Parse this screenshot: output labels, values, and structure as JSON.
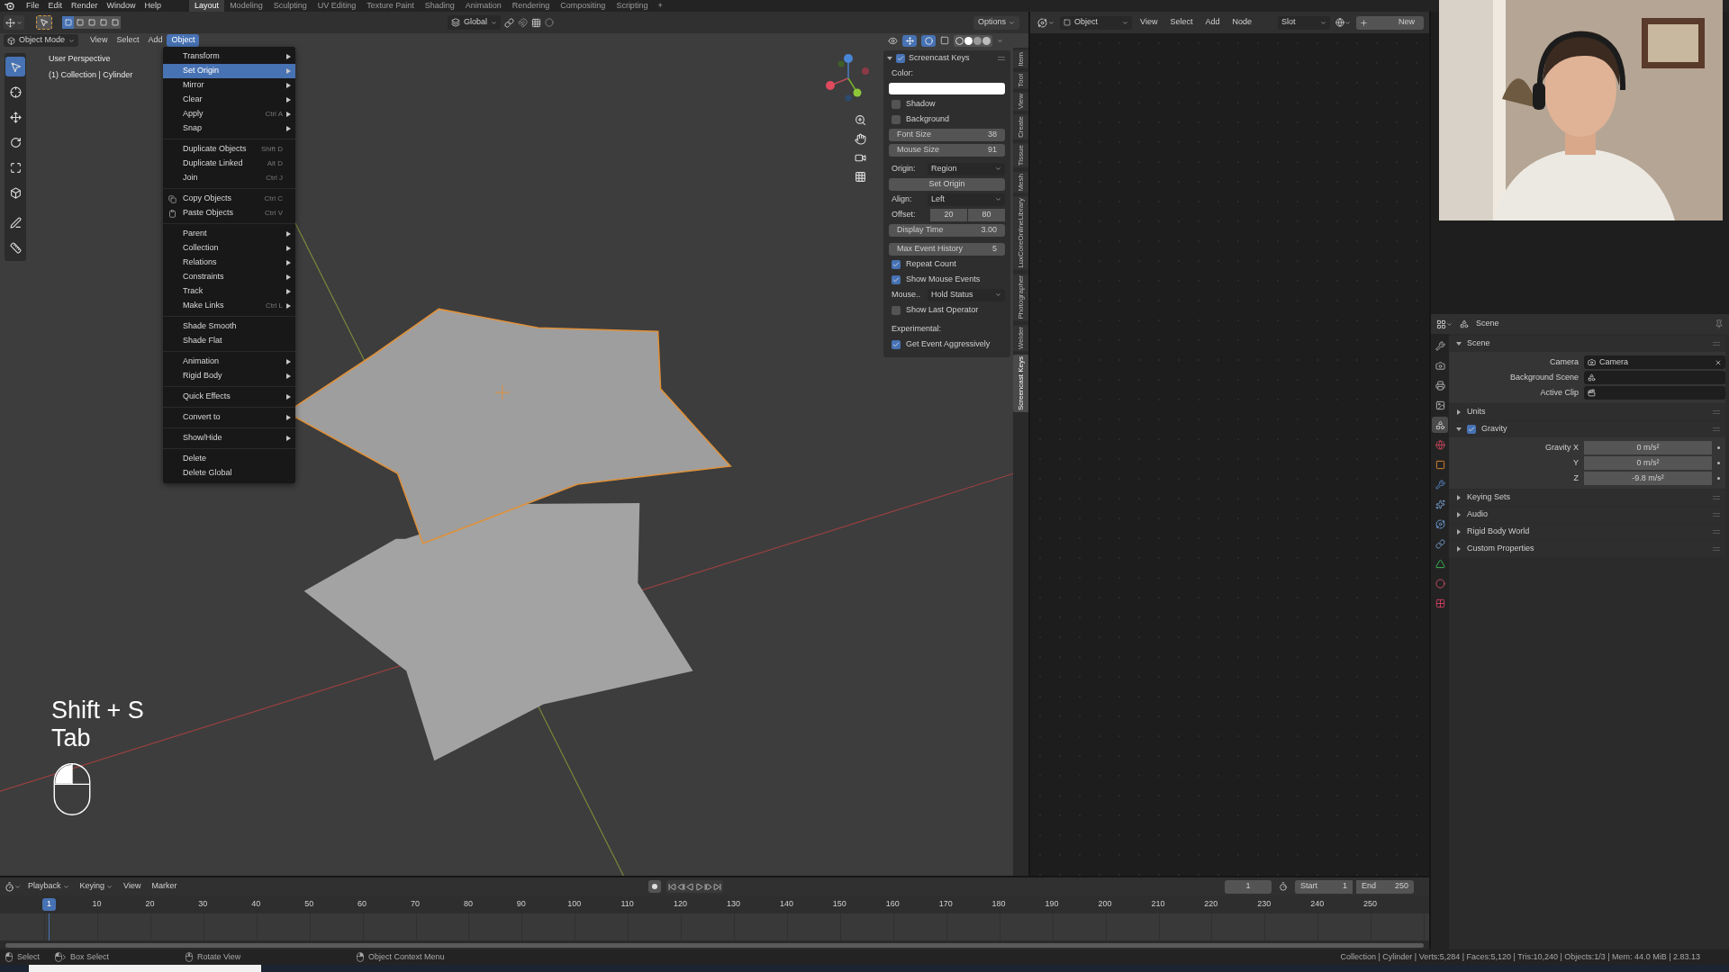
{
  "top_menu": [
    "File",
    "Edit",
    "Render",
    "Window",
    "Help"
  ],
  "workspaces": [
    {
      "label": "Layout",
      "selected": true
    },
    {
      "label": "Modeling",
      "selected": false
    },
    {
      "label": "Sculpting",
      "selected": false
    },
    {
      "label": "UV Editing",
      "selected": false
    },
    {
      "label": "Texture Paint",
      "selected": false
    },
    {
      "label": "Shading",
      "selected": false
    },
    {
      "label": "Animation",
      "selected": false
    },
    {
      "label": "Rendering",
      "selected": false
    },
    {
      "label": "Compositing",
      "selected": false
    },
    {
      "label": "Scripting",
      "selected": false
    }
  ],
  "add_workspace": "+",
  "tool_header": {
    "select_modes": [
      {
        "selected": true
      },
      {
        "selected": false
      },
      {
        "selected": false
      },
      {
        "selected": false
      },
      {
        "selected": false
      }
    ],
    "orientation": "Global",
    "options": "Options"
  },
  "viewport_header": {
    "mode": "Object Mode",
    "menus": [
      {
        "label": "View",
        "selected": false
      },
      {
        "label": "Select",
        "selected": false
      },
      {
        "label": "Add",
        "selected": false
      },
      {
        "label": "Object",
        "selected": true
      }
    ]
  },
  "viewport_info": [
    "User Perspective",
    "(1) Collection | Cylinder"
  ],
  "toolbar": [
    {
      "kind": "select",
      "selected": true
    },
    {
      "kind": "cursor",
      "selected": false
    },
    {
      "kind": "move",
      "selected": false
    },
    {
      "kind": "rotate",
      "selected": false
    },
    {
      "kind": "scale",
      "selected": false
    },
    {
      "kind": "transform",
      "selected": false
    },
    {
      "kind": "annotate",
      "selected": false
    },
    {
      "kind": "measure",
      "selected": false
    }
  ],
  "object_menu": {
    "groups": [
      [
        {
          "label": "Transform",
          "submenu": true,
          "selected": false
        },
        {
          "label": "Set Origin",
          "submenu": true,
          "selected": true
        },
        {
          "label": "Mirror",
          "submenu": true,
          "selected": false
        },
        {
          "label": "Clear",
          "submenu": true,
          "selected": false
        },
        {
          "label": "Apply",
          "shortcut": "Ctrl A",
          "submenu": true,
          "selected": false
        },
        {
          "label": "Snap",
          "submenu": true,
          "selected": false
        }
      ],
      [
        {
          "label": "Duplicate Objects",
          "shortcut": "Shift D",
          "submenu": false,
          "selected": false
        },
        {
          "label": "Duplicate Linked",
          "shortcut": "Alt D",
          "submenu": false,
          "selected": false
        },
        {
          "label": "Join",
          "shortcut": "Ctrl J",
          "submenu": false,
          "selected": false
        }
      ],
      [
        {
          "kind": "copy",
          "label": "Copy Objects",
          "shortcut": "Ctrl C",
          "submenu": false,
          "selected": false
        },
        {
          "kind": "paste",
          "label": "Paste Objects",
          "shortcut": "Ctrl V",
          "submenu": false,
          "selected": false
        }
      ],
      [
        {
          "label": "Parent",
          "submenu": true,
          "selected": false
        },
        {
          "label": "Collection",
          "submenu": true,
          "selected": false
        },
        {
          "label": "Relations",
          "submenu": true,
          "selected": false
        },
        {
          "label": "Constraints",
          "submenu": true,
          "selected": false
        },
        {
          "label": "Track",
          "submenu": true,
          "selected": false
        },
        {
          "label": "Make Links",
          "shortcut": "Ctrl L",
          "submenu": true,
          "selected": false
        }
      ],
      [
        {
          "label": "Shade Smooth",
          "submenu": false,
          "selected": false
        },
        {
          "label": "Shade Flat",
          "submenu": false,
          "selected": false
        }
      ],
      [
        {
          "label": "Animation",
          "submenu": true,
          "selected": false
        },
        {
          "label": "Rigid Body",
          "submenu": true,
          "selected": false
        }
      ],
      [
        {
          "label": "Quick Effects",
          "submenu": true,
          "selected": false
        }
      ],
      [
        {
          "label": "Convert to",
          "submenu": true,
          "selected": false
        }
      ],
      [
        {
          "label": "Show/Hide",
          "submenu": true,
          "selected": false
        }
      ],
      [
        {
          "label": "Delete",
          "submenu": false,
          "selected": false
        },
        {
          "label": "Delete Global",
          "submenu": false,
          "selected": false
        }
      ]
    ]
  },
  "screencast_keys": {
    "pressed": [
      "Shift + S",
      "Tab"
    ]
  },
  "n_panel": {
    "title": "Screencast Keys",
    "enabled": true,
    "groups": [
      [
        {
          "kind": "label",
          "label": "Color:"
        },
        {
          "kind": "color",
          "color": "#ffffff"
        },
        {
          "kind": "check",
          "label": "Shadow",
          "checked": false
        },
        {
          "kind": "check",
          "label": "Background",
          "checked": false
        },
        {
          "kind": "slider",
          "label": "Font Size",
          "value": "38"
        },
        {
          "kind": "slider",
          "label": "Mouse Size",
          "value": "91"
        }
      ],
      [
        {
          "kind": "dropdown",
          "label": "Origin:",
          "value": "Region"
        },
        {
          "kind": "button",
          "label": "Set Origin"
        },
        {
          "kind": "dropdown",
          "label": "Align:",
          "value": "Left"
        },
        {
          "kind": "pair",
          "label": "Offset:",
          "values": [
            "20",
            "80"
          ]
        },
        {
          "kind": "slider",
          "label": "Display Time",
          "value": "3.00"
        }
      ],
      [
        {
          "kind": "slider",
          "label": "Max Event History",
          "value": "5"
        },
        {
          "kind": "check",
          "label": "Repeat Count",
          "checked": true
        },
        {
          "kind": "check",
          "label": "Show Mouse Events",
          "checked": true
        },
        {
          "kind": "dropdown",
          "label": "Mouse..",
          "value": "Hold Status"
        },
        {
          "kind": "check",
          "label": "Show Last Operator",
          "checked": false
        }
      ],
      [
        {
          "kind": "label",
          "label": "Experimental:"
        },
        {
          "kind": "check",
          "label": "Get Event Aggressively",
          "checked": true
        }
      ]
    ],
    "tabs": [
      {
        "label": "Item",
        "selected": false
      },
      {
        "label": "Tool",
        "selected": false
      },
      {
        "label": "View",
        "selected": false
      },
      {
        "label": "Create",
        "selected": false
      },
      {
        "label": "Tissue",
        "selected": false
      },
      {
        "label": "Mesh",
        "selected": false
      },
      {
        "label": "LuxCoreOnlineLibrary",
        "selected": false
      },
      {
        "label": "Photographer",
        "selected": false
      },
      {
        "label": "Welder",
        "selected": false
      },
      {
        "label": "Screencast Keys",
        "selected": true
      }
    ]
  },
  "shader_header": {
    "context": "Object",
    "menus": [
      "View",
      "Select",
      "Add",
      "Node"
    ],
    "slot": "Slot",
    "new_button": "New"
  },
  "webcam": {
    "kind": "picture"
  },
  "properties": {
    "context": "Scene",
    "tabs": [
      {
        "kind": "tool",
        "selected": false
      },
      {
        "kind": "render",
        "selected": false
      },
      {
        "kind": "output",
        "selected": false
      },
      {
        "kind": "view_layer",
        "selected": false
      },
      {
        "kind": "scene",
        "selected": true
      },
      {
        "kind": "world",
        "selected": false
      },
      {
        "kind": "object",
        "selected": false
      },
      {
        "kind": "modifier",
        "selected": false
      },
      {
        "kind": "particles",
        "selected": false
      },
      {
        "kind": "physics",
        "selected": false
      },
      {
        "kind": "constraints",
        "selected": false
      },
      {
        "kind": "data",
        "selected": false
      },
      {
        "kind": "material",
        "selected": false
      },
      {
        "kind": "texture",
        "selected": false
      }
    ],
    "sections": [
      {
        "label": "Scene",
        "expanded": true,
        "fields": [
          {
            "label": "Camera",
            "kind": "camera",
            "value": "Camera",
            "clearable": true
          },
          {
            "label": "Background Scene",
            "kind": "scene",
            "clearable": false
          },
          {
            "label": "Active Clip",
            "kind": "clip",
            "clearable": false
          }
        ]
      },
      {
        "label": "Units",
        "expanded": false
      },
      {
        "label": "Gravity",
        "expanded": true,
        "checked": true,
        "fields": [
          {
            "label": "Gravity X",
            "kind": "number",
            "value": "0 m/s²"
          },
          {
            "label": "Y",
            "kind": "number",
            "value": "0 m/s²"
          },
          {
            "label": "Z",
            "kind": "number",
            "value": "-9.8 m/s²"
          }
        ]
      },
      {
        "label": "Keying Sets",
        "expanded": false
      },
      {
        "label": "Audio",
        "expanded": false
      },
      {
        "label": "Rigid Body World",
        "expanded": false
      },
      {
        "label": "Custom Properties",
        "expanded": false
      }
    ]
  },
  "timeline": {
    "menus": [
      {
        "label": "Playback",
        "dropdown": true
      },
      {
        "label": "Keying",
        "dropdown": true
      },
      {
        "label": "View",
        "dropdown": false
      },
      {
        "label": "Marker",
        "dropdown": false
      }
    ],
    "current_frame": "1",
    "start_label": "Start",
    "start": "1",
    "end_label": "End",
    "end": "250",
    "playhead": "1",
    "ticks": [
      "10",
      "20",
      "30",
      "40",
      "50",
      "60",
      "70",
      "80",
      "90",
      "100",
      "110",
      "120",
      "130",
      "140",
      "150",
      "160",
      "170",
      "180",
      "190",
      "200",
      "210",
      "220",
      "230",
      "240",
      "250"
    ]
  },
  "status_bar": {
    "hints": [
      {
        "label": "Select",
        "kind": "left"
      },
      {
        "label": "Box Select",
        "kind": "drag"
      },
      {
        "label": "Rotate View",
        "kind": "middle"
      },
      {
        "label": "Object Context Menu",
        "kind": "right"
      }
    ],
    "stats": "Collection | Cylinder | Verts:5,284 | Faces:5,120 | Tris:10,240 | Objects:1/3 | Mem: 44.0 MiB | 2.83.13"
  }
}
